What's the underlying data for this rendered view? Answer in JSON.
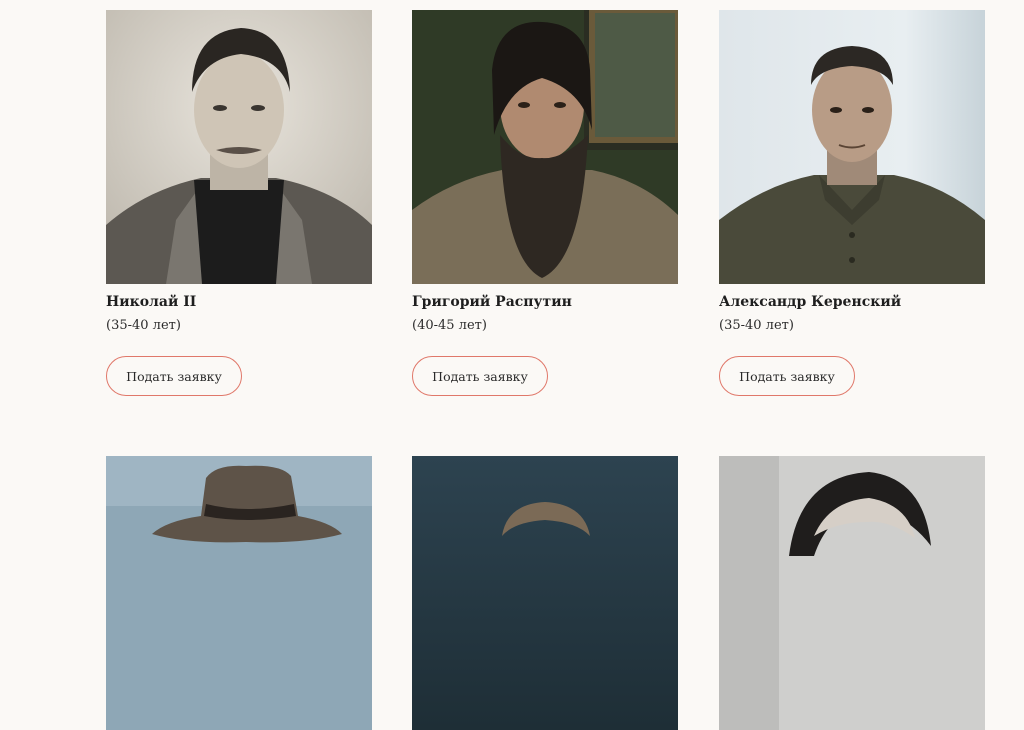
{
  "cards": [
    {
      "name": "Николай II",
      "age": "(35-40 лет)",
      "button": "Подать заявку"
    },
    {
      "name": "Григорий Распутин",
      "age": "(40-45 лет)",
      "button": "Подать заявку"
    },
    {
      "name": "Александр Керенский",
      "age": "(35-40 лет)",
      "button": "Подать заявку"
    },
    {},
    {},
    {}
  ],
  "colors": {
    "page_background": "#fbf9f6",
    "button_border": "#e0786a"
  }
}
